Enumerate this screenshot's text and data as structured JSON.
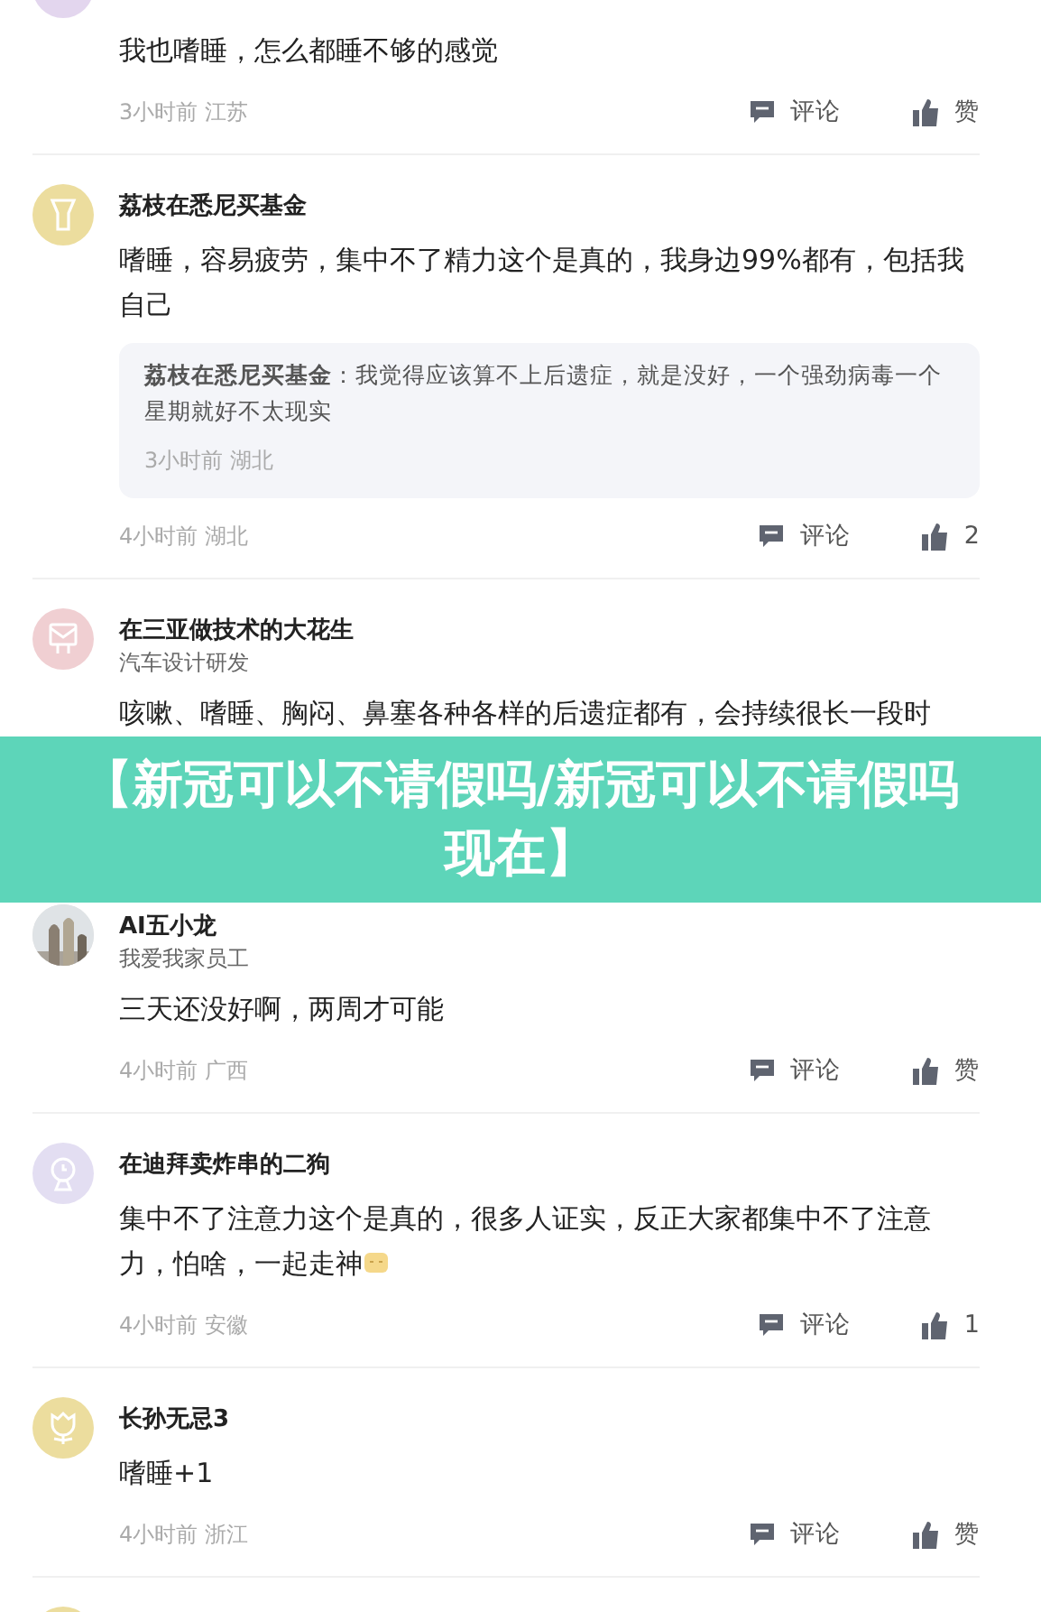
{
  "banner": {
    "title": "【新冠可以不请假吗/新冠可以不请假吗现在】"
  },
  "comments": [
    {
      "avatar": {
        "kind": "plain",
        "color": "#e3d6ee"
      },
      "cut_top": true,
      "text": "我也嗜睡，怎么都睡不够的感觉",
      "time": "3小时前",
      "place": "江苏",
      "reply_label": "评论",
      "like_label": "赞"
    },
    {
      "avatar": {
        "kind": "torch",
        "color": "#ecdd9e"
      },
      "name": "荔枝在悉尼买基金",
      "text": "嗜睡，容易疲劳，集中不了精力这个是真的，我身边99%都有，包括我自己",
      "replies": [
        {
          "name": "荔枝在悉尼买基金",
          "separator": "：",
          "text": "我觉得应该算不上后遗症，就是没好，一个强劲病毒一个星期就好不太现实",
          "time": "3小时前",
          "place": "湖北"
        }
      ],
      "time": "4小时前",
      "place": "湖北",
      "reply_label": "评论",
      "like_label": "2"
    },
    {
      "avatar": {
        "kind": "mail",
        "color": "#f0cfd2"
      },
      "name": "在三亚做技术的大花生",
      "subtitle": "汽车设计研发",
      "text": "咳嗽、嗜睡、胸闷、鼻塞各种各样的后遗症都有，会持续很长一段时"
    },
    {
      "name": "AI五小龙",
      "subtitle": "我爱我家员工",
      "text": "三天还没好啊，两周才可能",
      "time": "4小时前",
      "place": "广西",
      "reply_label": "评论",
      "like_label": "赞"
    },
    {
      "avatar": {
        "kind": "clock",
        "color": "#e3def2"
      },
      "name": "在迪拜卖炸串的二狗",
      "text": "集中不了注意力这个是真的，很多人证实，反正大家都集中不了注意力，怕啥，一起走神",
      "emoji": true,
      "time": "4小时前",
      "place": "安徽",
      "reply_label": "评论",
      "like_label": "1"
    },
    {
      "avatar": {
        "kind": "tulip",
        "color": "#ecdd9e"
      },
      "name": "长孙无忌3",
      "text": "嗜睡+1",
      "time": "4小时前",
      "place": "浙江",
      "reply_label": "评论",
      "like_label": "赞"
    },
    {
      "avatar": {
        "kind": "plain",
        "color": "#ecdd9e"
      }
    }
  ]
}
